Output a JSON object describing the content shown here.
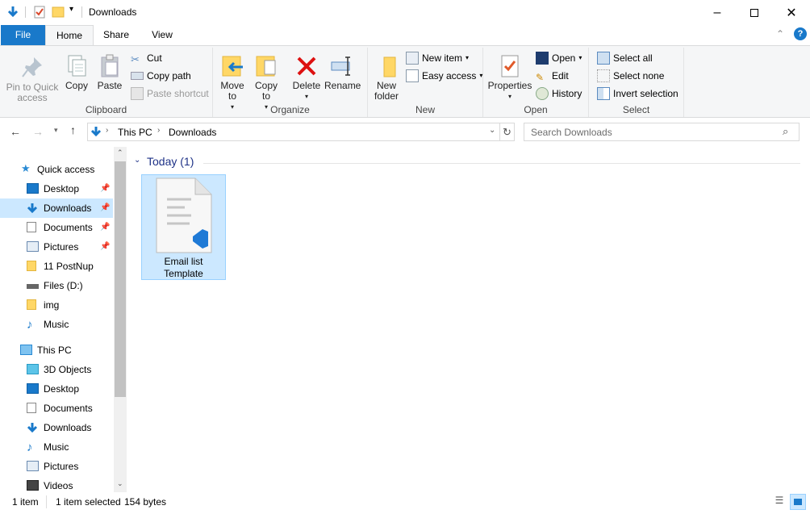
{
  "window": {
    "title": "Downloads",
    "minimize_icon": "minimize-icon",
    "maximize_icon": "maximize-icon",
    "close_icon": "close-icon"
  },
  "quick_access_toolbar": [
    "download-arrow-icon",
    "properties-icon",
    "new-folder-icon",
    "customize-dropdown-icon"
  ],
  "ribbon": {
    "tabs": [
      "File",
      "Home",
      "Share",
      "View"
    ],
    "active_tab": "Home",
    "groups": {
      "clipboard": {
        "label": "Clipboard",
        "pin": "Pin to Quick access",
        "copy": "Copy",
        "paste": "Paste",
        "cut": "Cut",
        "copy_path": "Copy path",
        "paste_shortcut": "Paste shortcut"
      },
      "organize": {
        "label": "Organize",
        "move_to": "Move to",
        "copy_to": "Copy to",
        "delete": "Delete",
        "rename": "Rename"
      },
      "new": {
        "label": "New",
        "new_folder": "New folder",
        "new_item": "New item",
        "easy_access": "Easy access"
      },
      "open": {
        "label": "Open",
        "properties": "Properties",
        "open": "Open",
        "edit": "Edit",
        "history": "History"
      },
      "select": {
        "label": "Select",
        "select_all": "Select all",
        "select_none": "Select none",
        "invert_selection": "Invert selection"
      }
    }
  },
  "address": {
    "crumbs": [
      "This PC",
      "Downloads"
    ],
    "search_placeholder": "Search Downloads"
  },
  "nav": {
    "quick_access": "Quick access",
    "quick_items": [
      {
        "label": "Desktop",
        "pinned": true
      },
      {
        "label": "Downloads",
        "pinned": true,
        "selected": true
      },
      {
        "label": "Documents",
        "pinned": true
      },
      {
        "label": "Pictures",
        "pinned": true
      },
      {
        "label": "11 PostNup",
        "pinned": false
      },
      {
        "label": "Files (D:)",
        "pinned": false
      },
      {
        "label": "img",
        "pinned": false
      },
      {
        "label": "Music",
        "pinned": false
      }
    ],
    "this_pc": "This PC",
    "pc_items": [
      "3D Objects",
      "Desktop",
      "Documents",
      "Downloads",
      "Music",
      "Pictures",
      "Videos"
    ]
  },
  "content": {
    "group_header": "Today (1)",
    "file": {
      "line1": "Email list",
      "line2": "Template"
    }
  },
  "status": {
    "count": "1 item",
    "selected": "1 item selected",
    "size": "154 bytes"
  },
  "colors": {
    "accent": "#1979ca",
    "selection": "#cce8ff",
    "selection_border": "#99d1ff",
    "nav_selected": "#cce8ff",
    "group_header": "#1e3287"
  }
}
